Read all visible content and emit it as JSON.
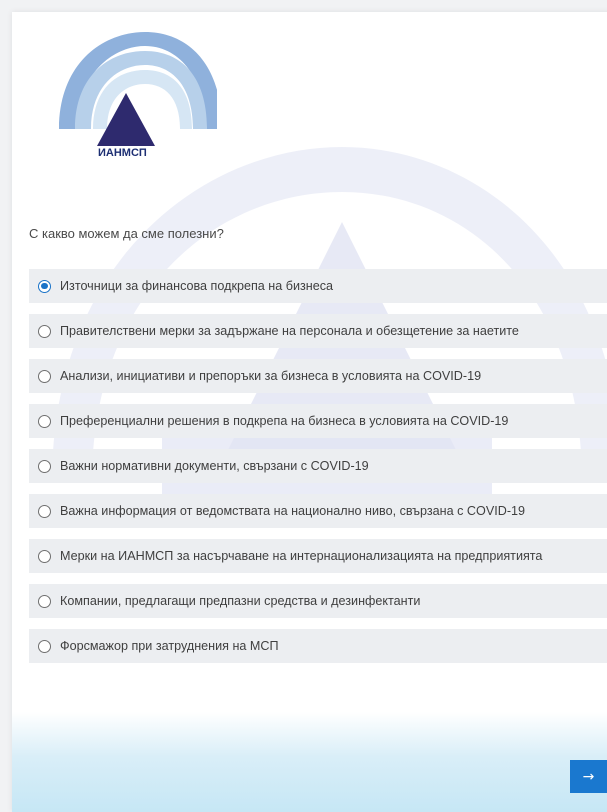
{
  "logo": {
    "text": "ИАНМСП",
    "icon": "ianmsp-logo-icon"
  },
  "survey": {
    "question": "С какво можем да сме полезни?",
    "selected_index": 0,
    "options": [
      {
        "label": "Източници за финансова подкрепа на бизнеса",
        "selected": true
      },
      {
        "label": "Правителствени мерки за задържане на персонала и обезщетение за наетите",
        "selected": false
      },
      {
        "label": "Анализи, инициативи и препоръки за бизнеса в условията на COVID-19",
        "selected": false
      },
      {
        "label": "Преференциални решения в подкрепа на бизнеса в условията на COVID-19",
        "selected": false
      },
      {
        "label": "Важни нормативни документи, свързани с COVID-19",
        "selected": false
      },
      {
        "label": "Важна информация от ведомствата на национално ниво, свързана с COVID-19",
        "selected": false
      },
      {
        "label": "Мерки на ИАНМСП за насърчаване на интернационализацията на предприятията",
        "selected": false
      },
      {
        "label": "Компании, предлагащи предпазни средства и дезинфектанти",
        "selected": false
      },
      {
        "label": "Форсмажор при затруднения на МСП",
        "selected": false
      }
    ]
  },
  "next_button": {
    "label": "→",
    "icon": "arrow-right-icon"
  },
  "colors": {
    "accent": "#1a78cf",
    "option_bg": "#eceef1",
    "logo_text": "#1d2f73"
  }
}
